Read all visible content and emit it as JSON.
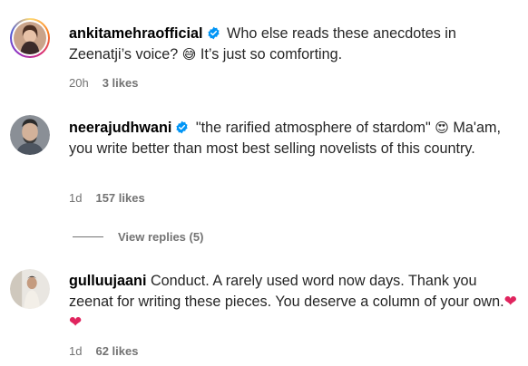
{
  "comments": [
    {
      "username": "ankitamehraofficial",
      "verified": true,
      "text": "Who else reads these anecdotes in Zeenatji’s voice?",
      "emoji": "😅",
      "text_after": "It’s just so comforting.",
      "time": "20h",
      "likes": "3 likes"
    },
    {
      "username": "neerajudhwani",
      "verified": true,
      "text": "\"the rarified atmosphere of stardom\"",
      "emoji": "😍",
      "text_after": "Ma'am, you write better than most best selling novelists of this country.",
      "time": "1d",
      "likes": "157 likes"
    },
    {
      "username": "gulluujaani",
      "verified": false,
      "text": "Conduct. A rarely used word now days. Thank you zeenat for writing these pieces. You deserve a column of your own.",
      "emoji": "❤ ❤",
      "time": "1d",
      "likes": "62 likes"
    }
  ],
  "view_replies": "View replies (5)",
  "colors": {
    "verified_blue": "#0095f6",
    "meta_gray": "#737373",
    "heart_red": "#e0245e"
  },
  "icons": [
    "verified-badge-icon",
    "avatar-photo"
  ]
}
